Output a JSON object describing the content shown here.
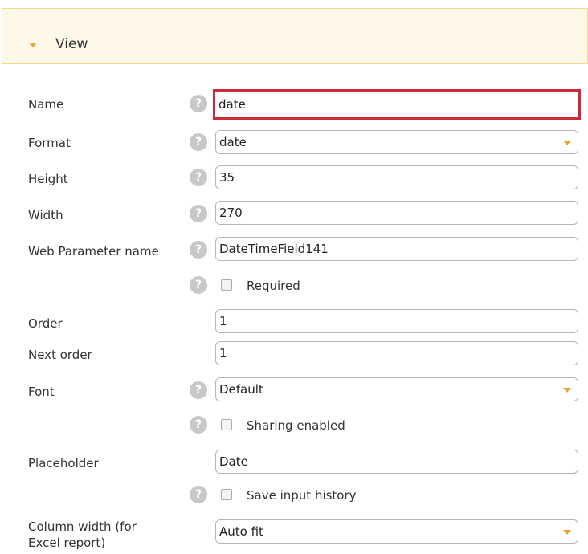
{
  "section": {
    "title": "View"
  },
  "fields": {
    "name": {
      "label": "Name",
      "value": "date"
    },
    "format": {
      "label": "Format",
      "value": "date"
    },
    "height": {
      "label": "Height",
      "value": "35"
    },
    "width": {
      "label": "Width",
      "value": "270"
    },
    "web_param": {
      "label": "Web Parameter name",
      "value": "DateTimeField141"
    },
    "required": {
      "label": "Required",
      "checked": false
    },
    "order": {
      "label": "Order",
      "value": "1"
    },
    "next_order": {
      "label": "Next order",
      "value": "1"
    },
    "font": {
      "label": "Font",
      "value": "Default"
    },
    "sharing": {
      "label": "Sharing enabled",
      "checked": false
    },
    "placeholder": {
      "label": "Placeholder",
      "value": "Date"
    },
    "save_history": {
      "label": "Save input history",
      "checked": false
    },
    "column_width": {
      "label_line1": "Column width (for",
      "label_line2": "Excel report)",
      "value": "Auto fit"
    }
  },
  "help_glyph": "?",
  "colors": {
    "accent": "#f0a030",
    "highlight": "#cc2a36",
    "header_bg": "#fdf8e8"
  }
}
